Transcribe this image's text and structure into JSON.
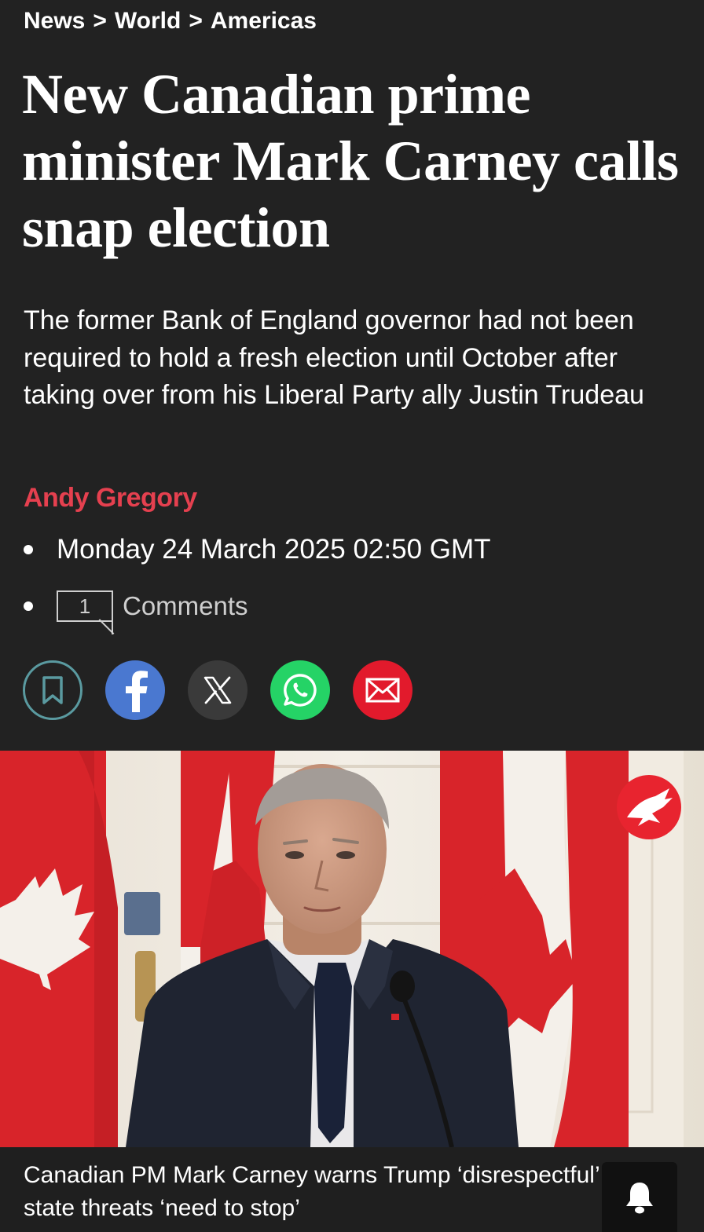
{
  "breadcrumb": {
    "items": [
      "News",
      "World",
      "Americas"
    ],
    "separator": ">"
  },
  "article": {
    "headline": "New Canadian prime minister Mark Carney calls snap election",
    "standfirst": "The former Bank of England governor had not been required to hold a fresh election until October after taking over from his Liberal Party ally Justin Trudeau",
    "author": "Andy Gregory",
    "date": "Monday 24 March 2025 02:50 GMT",
    "comments_count": "1",
    "comments_label": "Comments"
  },
  "share": {
    "buttons": [
      {
        "icon": "bookmark-icon",
        "color": "#5a9aa0"
      },
      {
        "icon": "facebook-icon",
        "color": "#4a78d0"
      },
      {
        "icon": "x-icon",
        "color": "#3a3a3a"
      },
      {
        "icon": "whatsapp-icon",
        "color": "#25d366"
      },
      {
        "icon": "email-icon",
        "color": "#e21a2c"
      }
    ]
  },
  "media": {
    "caption": "Canadian PM Mark Carney warns Trump ‘disrespectful’ 51st state threats ‘need to stop’",
    "logo_icon": "eagle-logo-icon",
    "notify_icon": "bell-icon"
  },
  "colors": {
    "background": "#222222",
    "author": "#e5404f",
    "flag_red": "#d8242a"
  }
}
